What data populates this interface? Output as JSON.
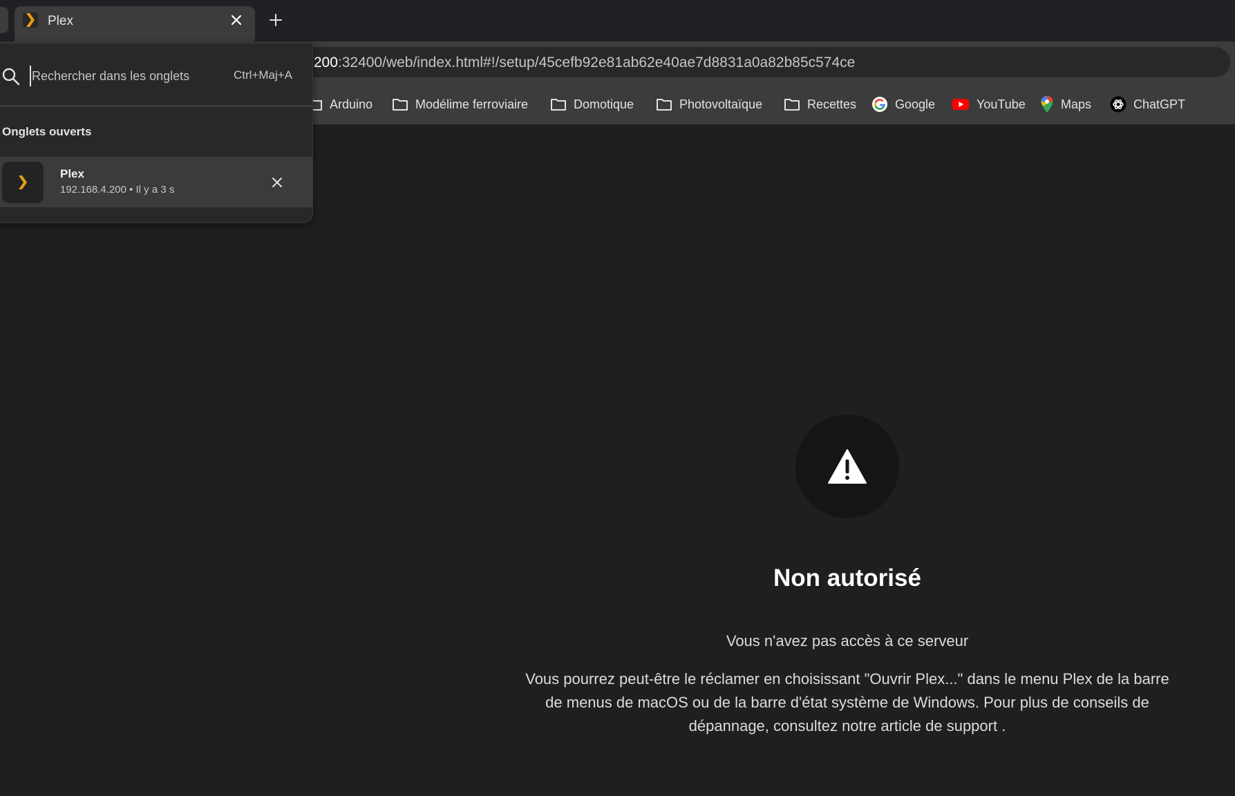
{
  "browser": {
    "tab": {
      "title": "Plex",
      "close_glyph": "✕"
    },
    "new_tab_glyph": "+",
    "address": {
      "url_host_part": ".200",
      "url_rest": ":32400/web/index.html#!/setup/45cefb92e81ab62e40ae7d8831a0a82b85c574ce"
    },
    "bookmarks": [
      {
        "label": "Arduino",
        "icon": "folder-icon"
      },
      {
        "label": "Modélime ferroviaire",
        "icon": "folder-icon"
      },
      {
        "label": "Domotique",
        "icon": "folder-icon"
      },
      {
        "label": "Photovoltaïque",
        "icon": "folder-icon"
      },
      {
        "label": "Recettes",
        "icon": "folder-icon"
      },
      {
        "label": "Google",
        "icon": "google-icon"
      },
      {
        "label": "YouTube",
        "icon": "youtube-icon"
      },
      {
        "label": "Maps",
        "icon": "maps-icon"
      },
      {
        "label": "ChatGPT",
        "icon": "chatgpt-icon"
      }
    ]
  },
  "tab_search": {
    "placeholder": "Rechercher dans les onglets",
    "shortcut": "Ctrl+Maj+A",
    "section_heading": "Onglets ouverts",
    "results": [
      {
        "title": "Plex",
        "meta": "192.168.4.200 • Il y a 3 s"
      }
    ]
  },
  "page": {
    "title": "Non autorisé",
    "subtitle": "Vous n'avez pas accès à ce serveur",
    "body": "Vous pourrez peut-être le réclamer en choisissant \"Ouvrir Plex...\" dans le menu Plex de la barre de menus de macOS ou de la barre d'état système de Windows. Pour plus de conseils de dépannage, consultez notre article de support ."
  },
  "colors": {
    "plex_accent": "#e5a00d",
    "background": "#1f1f1f",
    "toolbar": "#3c3c3c"
  }
}
